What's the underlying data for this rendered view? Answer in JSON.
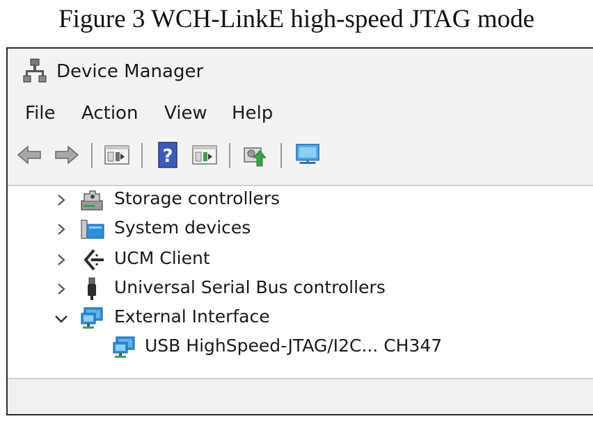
{
  "caption": "Figure 3 WCH-LinkE high-speed JTAG mode",
  "window": {
    "title": "Device Manager",
    "title_icon": "device-manager-icon"
  },
  "menu": {
    "items": [
      "File",
      "Action",
      "View",
      "Help"
    ]
  },
  "toolbar": {
    "buttons": [
      "back-arrow-icon",
      "forward-arrow-icon",
      "properties-icon",
      "help-icon",
      "show-hide-icon",
      "update-driver-icon",
      "scan-hardware-icon"
    ]
  },
  "tree": {
    "items": [
      {
        "label": "Storage controllers",
        "icon": "storage-controller-icon",
        "state": "collapsed"
      },
      {
        "label": "System devices",
        "icon": "system-devices-icon",
        "state": "collapsed"
      },
      {
        "label": "UCM Client",
        "icon": "ucm-client-icon",
        "state": "collapsed"
      },
      {
        "label": "Universal Serial Bus controllers",
        "icon": "usb-icon",
        "state": "collapsed"
      },
      {
        "label": "External Interface",
        "icon": "network-icon",
        "state": "expanded"
      },
      {
        "label": "USB HighSpeed-JTAG/I2C... CH347",
        "icon": "network-icon",
        "state": "child"
      }
    ]
  },
  "colors": {
    "accent": "#2e8fd6",
    "window_bg": "#f3f3f3",
    "tree_bg": "#ffffff",
    "green": "#3aa04a"
  }
}
